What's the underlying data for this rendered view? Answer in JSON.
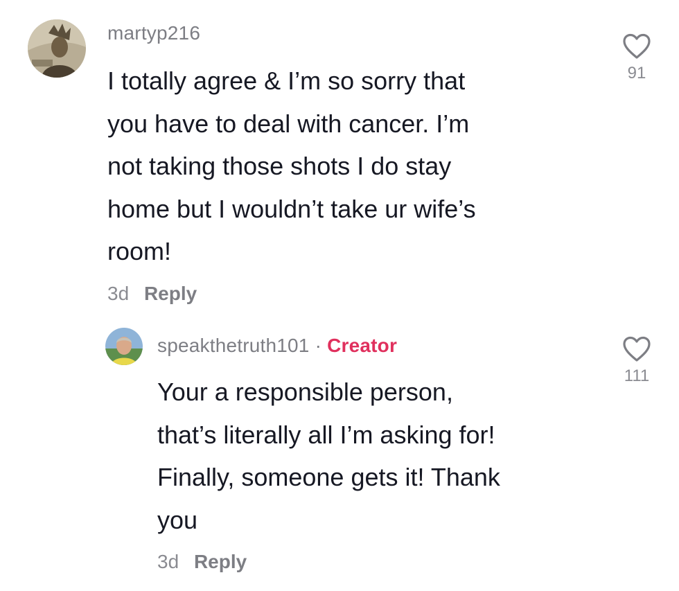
{
  "comments": [
    {
      "username": "martyp216",
      "text_lines": [
        "I totally agree & I’m so sorry that",
        "you have to deal with cancer. I’m",
        "not taking those shots I do stay",
        "home but I wouldn’t take ur wife’s",
        "room!"
      ],
      "time": "3d",
      "reply_label": "Reply",
      "likes": "91",
      "heart_icon": "heart-outline-icon"
    },
    {
      "username": "speakthetruth101",
      "separator": "·",
      "badge": "Creator",
      "badge_color": "#e0305d",
      "text_lines": [
        "Your a responsible person,",
        "that’s literally all I’m asking for!",
        "Finally, someone gets it! Thank",
        "you"
      ],
      "time": "3d",
      "reply_label": "Reply",
      "likes": "111",
      "heart_icon": "heart-outline-icon"
    }
  ]
}
